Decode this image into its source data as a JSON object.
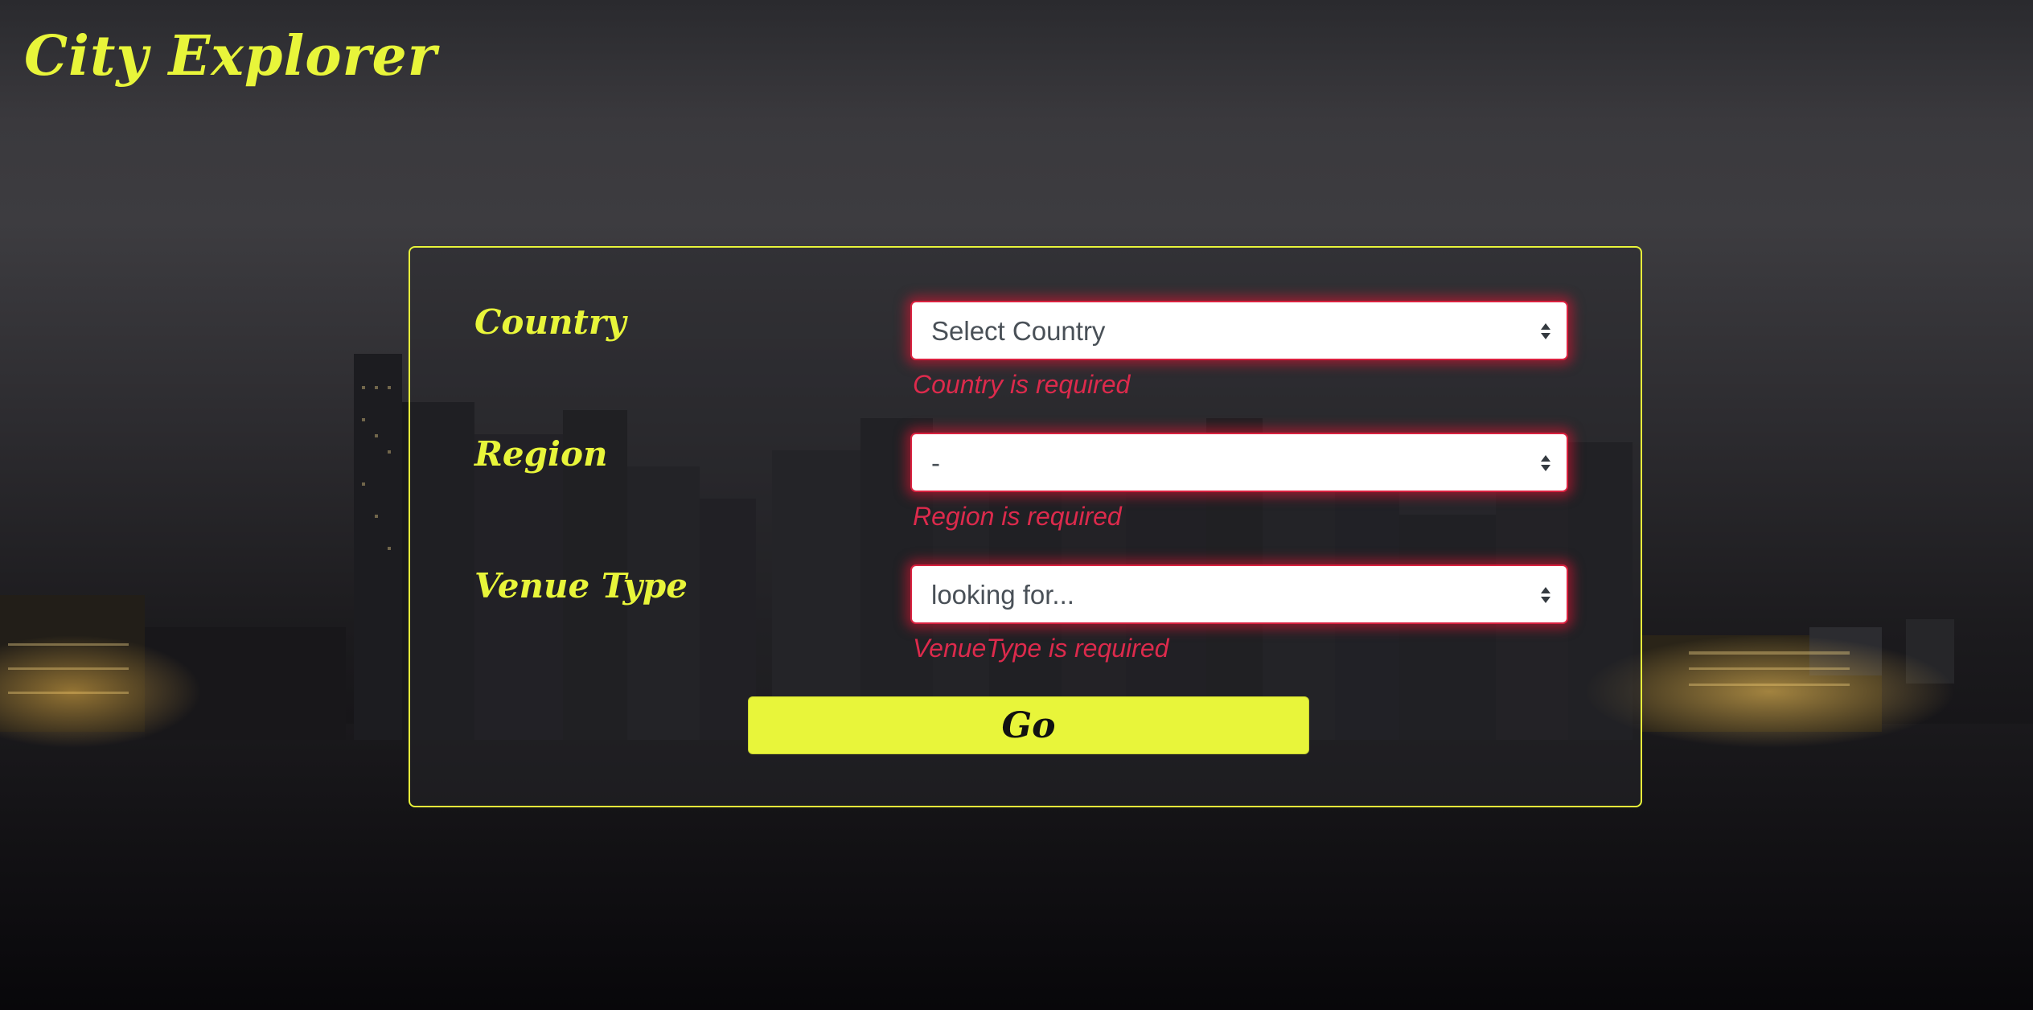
{
  "header": {
    "title": "City Explorer"
  },
  "form": {
    "country": {
      "label": "Country",
      "value": "Select Country",
      "error": "Country is required"
    },
    "region": {
      "label": "Region",
      "value": "-",
      "error": "Region is required"
    },
    "venue_type": {
      "label": "Venue Type",
      "value": "looking for...",
      "error": "VenueType is required"
    },
    "submit_label": "Go"
  },
  "colors": {
    "accent": "#e8f53a",
    "error": "#dc2a4c",
    "card_border": "#e8f53a"
  },
  "icons": {
    "select_arrow": "sort-arrows-icon"
  }
}
